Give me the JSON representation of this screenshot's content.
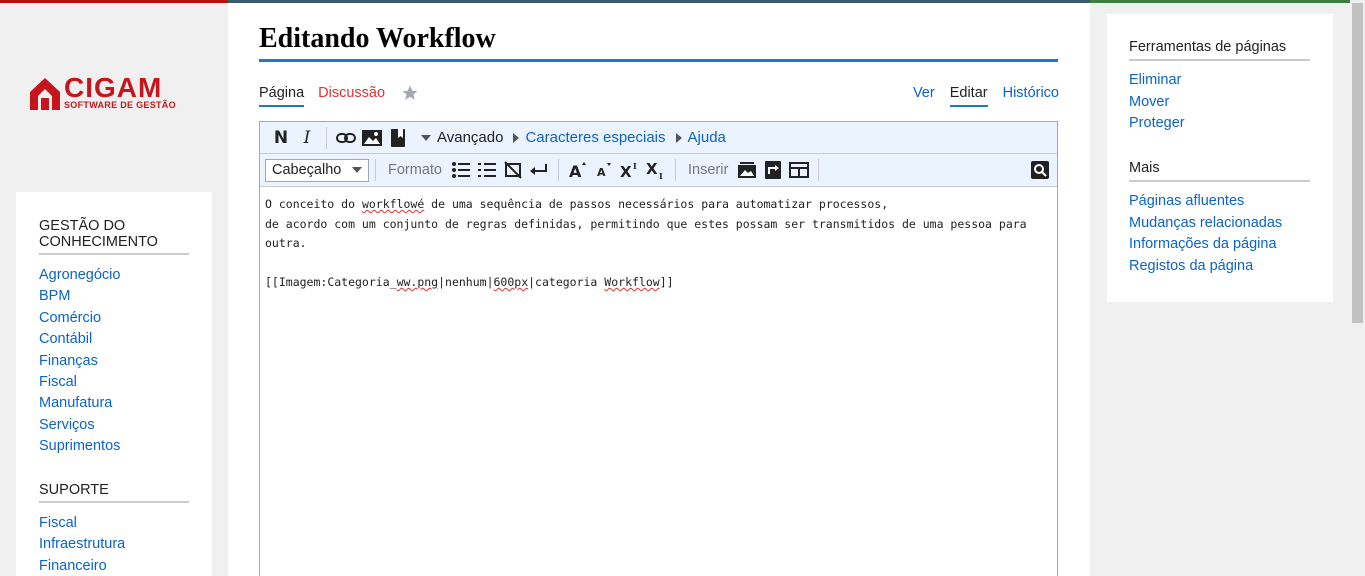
{
  "logo": {
    "name": "CIGAM",
    "tagline": "SOFTWARE DE GESTÃO"
  },
  "left_sidebar": {
    "portals": [
      {
        "heading": "GESTÃO DO CONHECIMENTO",
        "items": [
          "Agronegócio",
          "BPM",
          "Comércio",
          "Contábil",
          "Finanças",
          "Fiscal",
          "Manufatura",
          "Serviços",
          "Suprimentos"
        ]
      },
      {
        "heading": "SUPORTE",
        "items": [
          "Fiscal",
          "Infraestrutura",
          "Financeiro"
        ]
      }
    ]
  },
  "page": {
    "title": "Editando Workflow",
    "tabs_left": [
      "Página",
      "Discussão"
    ],
    "tabs_right": [
      "Ver",
      "Editar",
      "Histórico"
    ]
  },
  "toolbar": {
    "row1": {
      "advanced": "Avançado",
      "special_chars": "Caracteres especiais",
      "help": "Ajuda"
    },
    "row2": {
      "heading_select": "Cabeçalho",
      "format_label": "Formato",
      "insert_label": "Inserir"
    }
  },
  "editor": {
    "line1_pre": "O conceito do ",
    "line1_word": "workflowé",
    "line1_post": " de uma sequência de passos necessários para automatizar processos,",
    "line2": "de acordo com um conjunto de regras definidas, permitindo que estes possam ser transmitidos de uma pessoa para",
    "line3": "outra.",
    "code_a": "[[Imagem",
    "code_b": ":Categoria_",
    "code_c": "ww.png",
    "code_d": "|nenhum|",
    "code_e": "600px",
    "code_f": "|categoria ",
    "code_g": "Workflow",
    "code_h": "]]"
  },
  "right_sidebar": {
    "sections": [
      {
        "heading": "Ferramentas de páginas",
        "items": [
          "Eliminar",
          "Mover",
          "Proteger"
        ]
      },
      {
        "heading": "Mais",
        "items": [
          "Páginas afluentes",
          "Mudanças relacionadas",
          "Informações da página",
          "Registos da página"
        ]
      }
    ]
  },
  "colors": {
    "link": "#0b63c6",
    "brand_red": "#c4161c",
    "title_line": "#1a7bc4",
    "toolbar_bg": "#eaf3ff"
  }
}
